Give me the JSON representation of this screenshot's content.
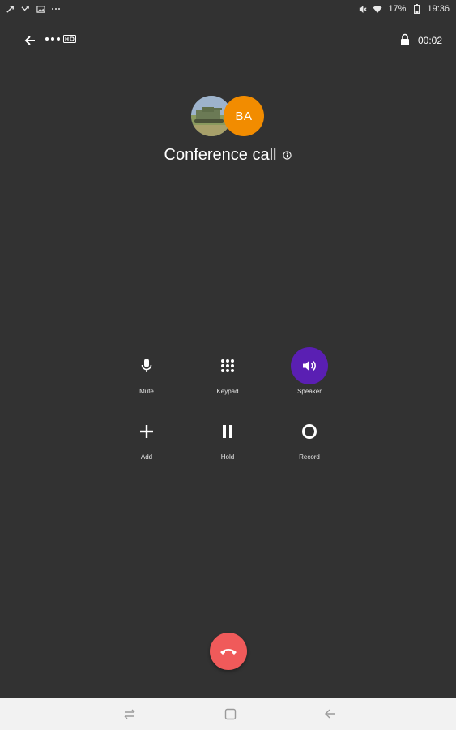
{
  "status_bar": {
    "left_icons": [
      "call-forward-icon",
      "missed-call-icon",
      "image-icon",
      "more-dots-icon"
    ],
    "right_icons": [
      "mute-icon",
      "wifi-icon"
    ],
    "battery": "17%",
    "time": "19:36"
  },
  "top_bar": {
    "timer": "00:02"
  },
  "call": {
    "avatar_initials": "BA",
    "title": "Conference call"
  },
  "controls": [
    {
      "label": "Mute",
      "icon": "microphone-icon",
      "active": false
    },
    {
      "label": "Keypad",
      "icon": "dialpad-icon",
      "active": false
    },
    {
      "label": "Speaker",
      "icon": "speaker-icon",
      "active": true
    },
    {
      "label": "Add",
      "icon": "plus-icon",
      "active": false
    },
    {
      "label": "Hold",
      "icon": "pause-icon",
      "active": false
    },
    {
      "label": "Record",
      "icon": "record-icon",
      "active": false
    }
  ],
  "colors": {
    "background": "#323232",
    "avatar_orange": "#f28c00",
    "speaker_active": "#5a1fb3",
    "end_call_red": "#f05a5a",
    "nav_bar": "#f2f2f2"
  }
}
